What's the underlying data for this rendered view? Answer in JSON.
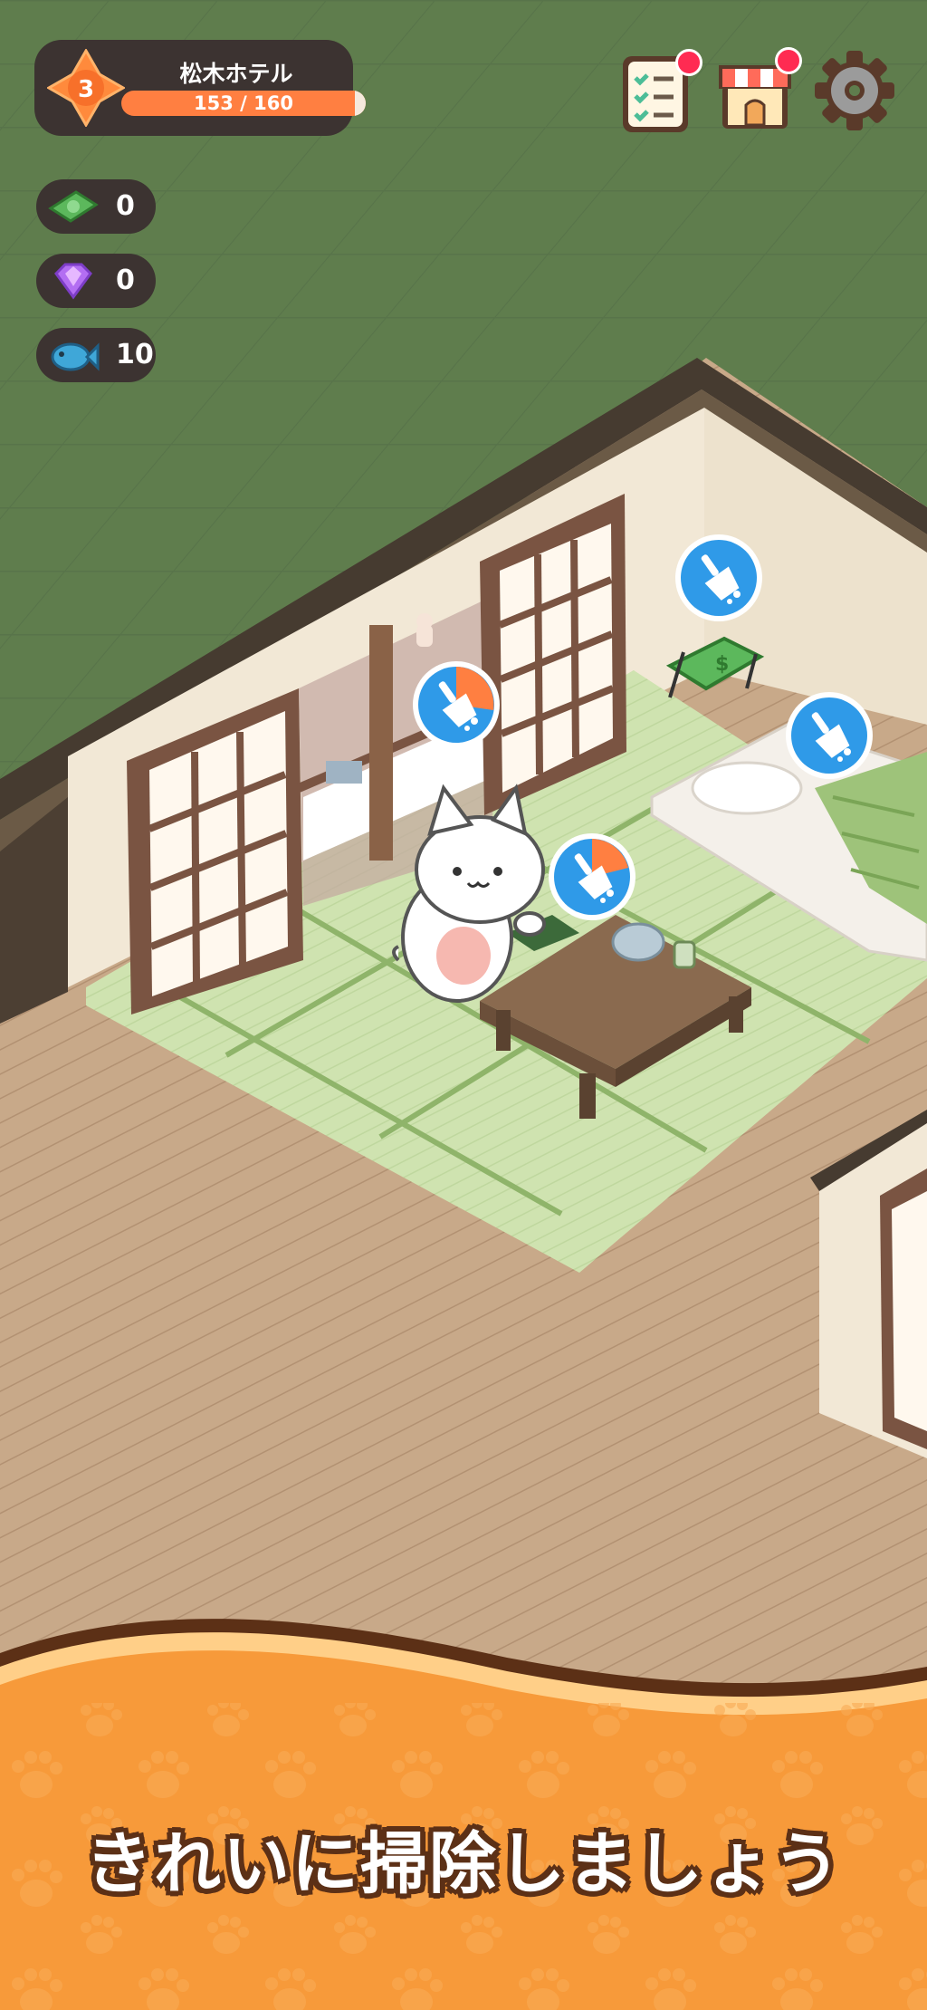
{
  "hud": {
    "hotel_name": "松木ホテル",
    "level": "3",
    "xp_text": "153 / 160",
    "xp_progress": 0.956
  },
  "resources": [
    {
      "name": "cash-icon",
      "value": "0"
    },
    {
      "name": "gem-icon",
      "value": "0"
    },
    {
      "name": "fish-icon",
      "value": "10"
    }
  ],
  "top_buttons": [
    {
      "name": "task-list-icon",
      "has_notification": true
    },
    {
      "name": "shop-icon",
      "has_notification": true
    },
    {
      "name": "settings-gear-icon",
      "has_notification": false
    }
  ],
  "cleaning_bubbles": [
    {
      "name": "broom-icon",
      "progress": 0.42
    },
    {
      "name": "broom-icon",
      "progress": 0.0
    },
    {
      "name": "broom-icon",
      "progress": 0.0
    },
    {
      "name": "broom-icon",
      "progress": 0.38
    }
  ],
  "banner": {
    "text": "きれいに掃除しましょう"
  },
  "colors": {
    "hud_dark": "#3c3331",
    "accent_orange": "#ff7f41",
    "notification_red": "#ff2b52",
    "broom_blue": "#2f9ae8",
    "banner_orange": "#f79a3a",
    "grass_green": "#5f7d4d"
  }
}
